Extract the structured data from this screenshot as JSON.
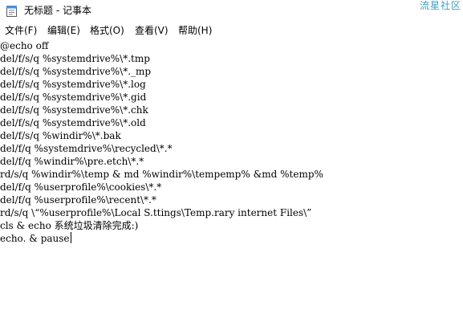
{
  "window": {
    "title": "无标题 - 记事本",
    "watermark": "流星社区",
    "watermark_color": "#3aa0c4"
  },
  "menu": {
    "items": [
      {
        "label": "文件(F)"
      },
      {
        "label": "编辑(E)"
      },
      {
        "label": "格式(O)"
      },
      {
        "label": "查看(V)"
      },
      {
        "label": "帮助(H)"
      }
    ]
  },
  "editor": {
    "lines": [
      "@echo off",
      "del/f/s/q %systemdrive%\\*.tmp",
      "del/f/s/q %systemdrive%\\*._mp",
      "del/f/s/q %systemdrive%\\*.log",
      "del/f/s/q %systemdrive%\\*.gid",
      "del/f/s/q %systemdrive%\\*.chk",
      "del/f/s/q %systemdrive%\\*.old",
      "del/f/s/q %windir%\\*.bak",
      "del/f/q %systemdrive%\\recycled\\*.*",
      "del/f/q %windir%\\pre.etch\\*.*",
      "rd/s/q %windir%\\temp & md %windir%\\tempemp% &md %temp%",
      "del/f/q %userprofile%\\cookies\\*.*",
      "del/f/q %userprofile%\\recent\\*.*",
      "rd/s/q \\“%userprofile%\\Local S.ttings\\Temp.rary internet Files\\”",
      "cls & echo 系统垃圾清除完成:)",
      "echo. & pause"
    ]
  }
}
